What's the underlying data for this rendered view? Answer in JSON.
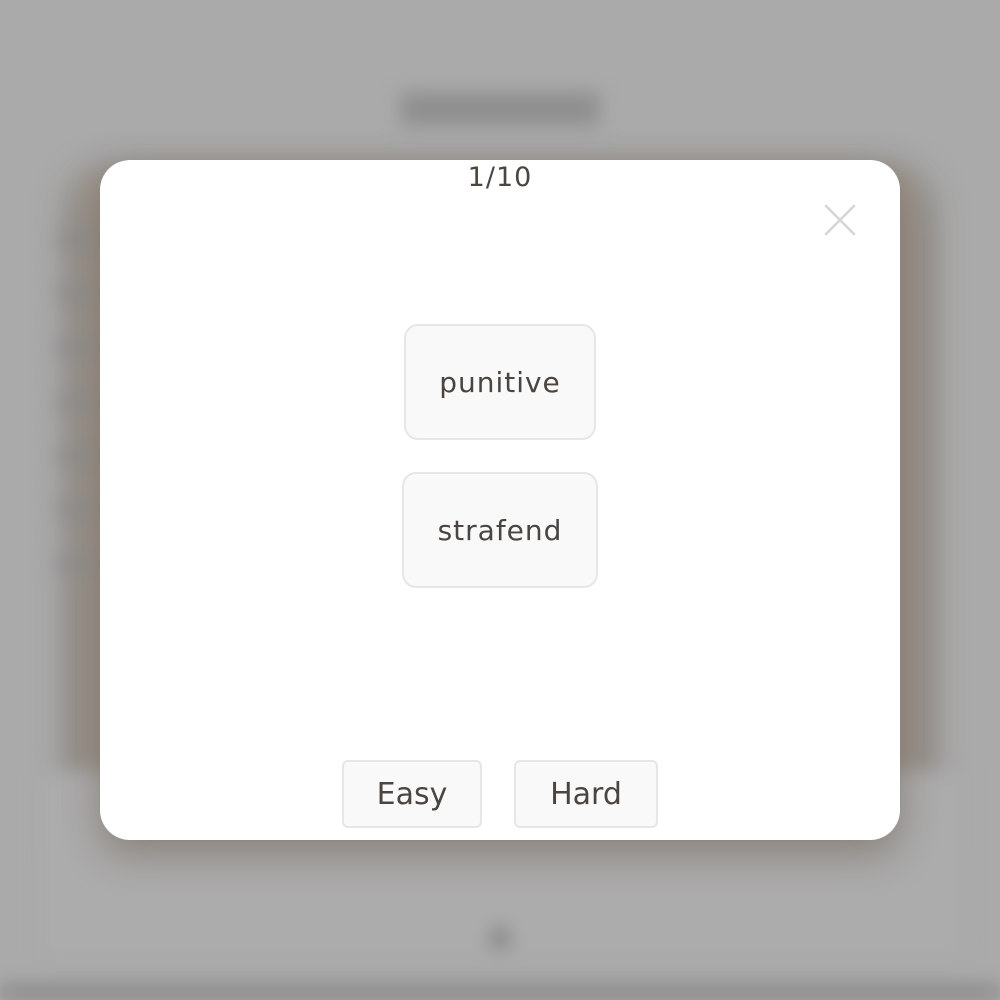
{
  "flashcard_modal": {
    "progress": "1/10",
    "front_word": "punitive",
    "back_word": "strafend",
    "easy_label": "Easy",
    "hard_label": "Hard",
    "close_icon": "close-icon"
  },
  "colors": {
    "overlay": "#aaaaaa",
    "modal_background": "#ffffff",
    "card_background": "#f9f9f9",
    "card_border": "#e6e6e6",
    "text": "#4a4540",
    "close_icon": "#d6d6d6"
  }
}
